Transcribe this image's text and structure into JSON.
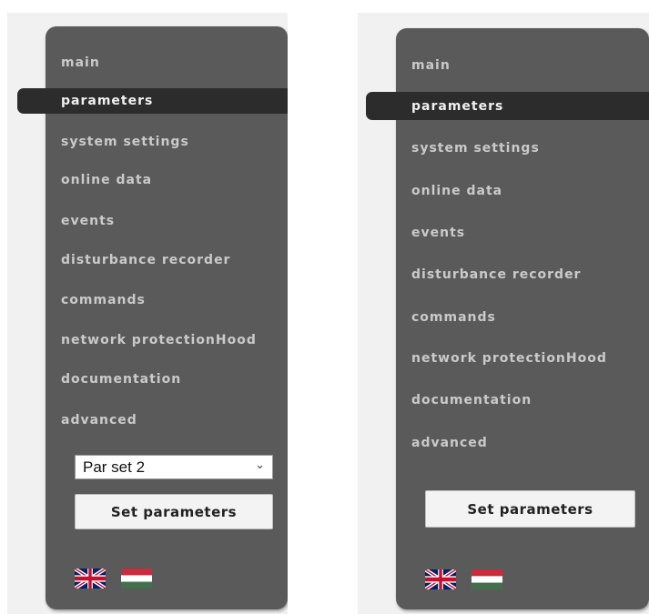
{
  "left_panel": {
    "nav_items": [
      {
        "label": "main"
      },
      {
        "label": "parameters",
        "active": true
      },
      {
        "label": "system settings"
      },
      {
        "label": "online data"
      },
      {
        "label": "events"
      },
      {
        "label": "disturbance recorder"
      },
      {
        "label": "commands"
      },
      {
        "label": "network protectionHood"
      },
      {
        "label": "documentation"
      },
      {
        "label": "advanced"
      }
    ],
    "param_set_select": {
      "selected": "Par set 2"
    },
    "set_parameters_label": "Set parameters",
    "languages": [
      {
        "icon": "uk-flag-icon"
      },
      {
        "icon": "hungary-flag-icon"
      }
    ]
  },
  "right_panel": {
    "nav_items": [
      {
        "label": "main"
      },
      {
        "label": "parameters",
        "active": true
      },
      {
        "label": "system settings"
      },
      {
        "label": "online data"
      },
      {
        "label": "events"
      },
      {
        "label": "disturbance recorder"
      },
      {
        "label": "commands"
      },
      {
        "label": "network protectionHood"
      },
      {
        "label": "documentation"
      },
      {
        "label": "advanced"
      }
    ],
    "set_parameters_label": "Set parameters",
    "languages": [
      {
        "icon": "uk-flag-icon"
      },
      {
        "icon": "hungary-flag-icon"
      }
    ]
  },
  "colors": {
    "panel": "#5a5a5a",
    "active_tab": "#2c2c2c",
    "nav_text": "#cacaca",
    "hu_red": "#cd2a3e",
    "hu_white": "#ffffff",
    "hu_green": "#436f4d",
    "uk_blue": "#012169",
    "uk_red": "#c8102e"
  }
}
